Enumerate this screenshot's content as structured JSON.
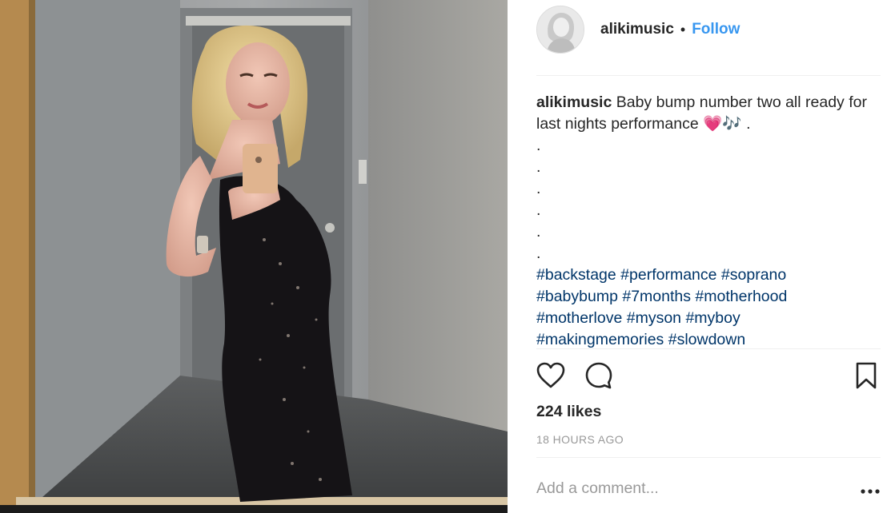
{
  "post": {
    "username": "alikimusic",
    "follow_label": "Follow",
    "caption_username": "alikimusic",
    "caption_text": "Baby bump number two all ready for last nights performance 💗🎶 .",
    "caption_dots": [
      ".",
      ".",
      ".",
      ".",
      ".",
      "."
    ],
    "hashtags": [
      "#backstage",
      "#performance",
      "#soprano",
      "#babybump",
      "#7months",
      "#motherhood",
      "#motherlove",
      "#myson",
      "#myboy",
      "#makingmemories",
      "#slowdown"
    ],
    "likes": "224 likes",
    "time": "18 HOURS AGO",
    "comment_placeholder": "Add a comment..."
  },
  "icons": {
    "like": "heart-icon",
    "comment": "comment-bubble-icon",
    "save": "bookmark-icon",
    "more": "more-options-icon"
  },
  "colors": {
    "follow": "#3897f0",
    "hashtag": "#003569",
    "muted": "#999999",
    "divider": "#efefef"
  }
}
